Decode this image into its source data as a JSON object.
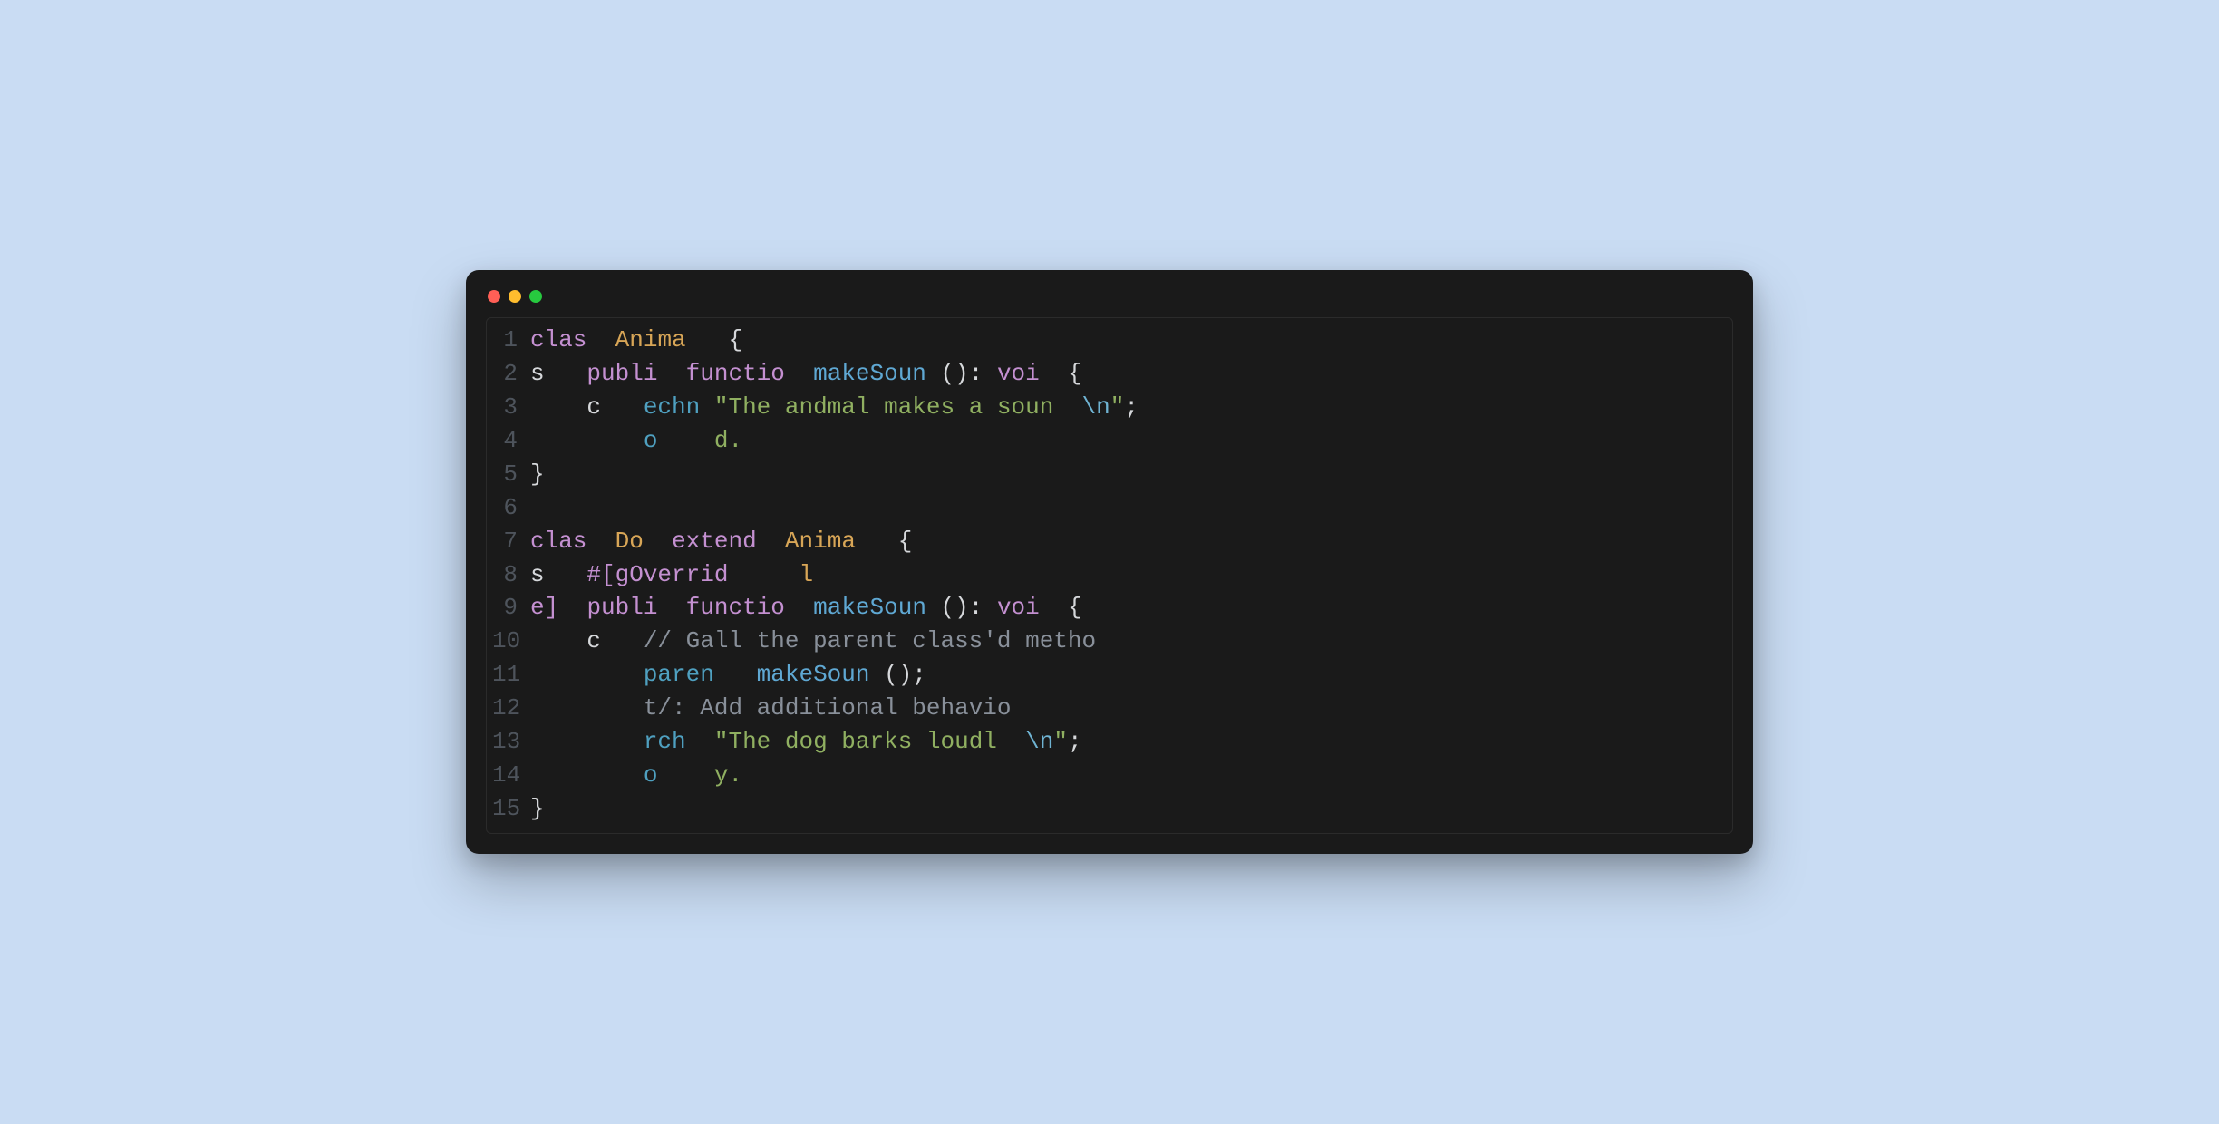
{
  "window": {
    "traffic_lights": [
      "red",
      "yellow",
      "green"
    ]
  },
  "editor": {
    "line_count": 15,
    "lines": [
      {
        "n": 1,
        "tokens": [
          [
            "kw",
            "clas"
          ],
          [
            "punc",
            "  "
          ],
          [
            "cls",
            "Anima"
          ],
          [
            "punc",
            "   {"
          ]
        ]
      },
      {
        "n": 2,
        "tokens": [
          [
            "punc",
            "s   "
          ],
          [
            "kw",
            "publi"
          ],
          [
            "punc",
            "  "
          ],
          [
            "kw",
            "functio"
          ],
          [
            "punc",
            "  "
          ],
          [
            "fn",
            "makeSoun"
          ],
          [
            "punc",
            " (): "
          ],
          [
            "type",
            "voi"
          ],
          [
            "punc",
            "  {"
          ]
        ]
      },
      {
        "n": 3,
        "tokens": [
          [
            "punc",
            "    c   "
          ],
          [
            "echo",
            "echn"
          ],
          [
            "punc",
            " "
          ],
          [
            "str",
            "\"The andmal makes a soun  "
          ],
          [
            "esc",
            "\\n"
          ],
          [
            "str",
            "\""
          ],
          [
            "punc",
            ";"
          ]
        ]
      },
      {
        "n": 4,
        "tokens": [
          [
            "punc",
            "        "
          ],
          [
            "echo",
            "o"
          ],
          [
            "punc",
            "    "
          ],
          [
            "str",
            "d."
          ]
        ]
      },
      {
        "n": 5,
        "tokens": [
          [
            "punc",
            "}"
          ]
        ]
      },
      {
        "n": 6,
        "tokens": [
          [
            "punc",
            " "
          ]
        ]
      },
      {
        "n": 7,
        "tokens": [
          [
            "kw",
            "clas"
          ],
          [
            "punc",
            "  "
          ],
          [
            "cls",
            "Do"
          ],
          [
            "punc",
            "  "
          ],
          [
            "kw",
            "extend"
          ],
          [
            "punc",
            "  "
          ],
          [
            "cls",
            "Anima"
          ],
          [
            "punc",
            "   {"
          ]
        ]
      },
      {
        "n": 8,
        "tokens": [
          [
            "punc",
            "s   "
          ],
          [
            "attr",
            "#[gOverrid"
          ],
          [
            "punc",
            "     "
          ],
          [
            "cls",
            "l"
          ]
        ]
      },
      {
        "n": 9,
        "tokens": [
          [
            "attr",
            "e]"
          ],
          [
            "punc",
            "  "
          ],
          [
            "kw",
            "publi"
          ],
          [
            "punc",
            "  "
          ],
          [
            "kw",
            "functio"
          ],
          [
            "punc",
            "  "
          ],
          [
            "fn",
            "makeSoun"
          ],
          [
            "punc",
            " (): "
          ],
          [
            "type",
            "voi"
          ],
          [
            "punc",
            "  {"
          ]
        ]
      },
      {
        "n": 10,
        "tokens": [
          [
            "punc",
            "    c   "
          ],
          [
            "com",
            "// Gall the parent class'd metho"
          ]
        ]
      },
      {
        "n": 11,
        "tokens": [
          [
            "punc",
            "        "
          ],
          [
            "echo",
            "paren"
          ],
          [
            "punc",
            "   "
          ],
          [
            "fn",
            "makeSoun"
          ],
          [
            "punc",
            " ();"
          ]
        ]
      },
      {
        "n": 12,
        "tokens": [
          [
            "punc",
            "        "
          ],
          [
            "com",
            "t/:"
          ],
          [
            "punc",
            " "
          ],
          [
            "com",
            "Add additional behavio"
          ]
        ]
      },
      {
        "n": 13,
        "tokens": [
          [
            "punc",
            "        "
          ],
          [
            "echo",
            "rch"
          ],
          [
            "punc",
            "  "
          ],
          [
            "str",
            "\"The dog barks loudl  "
          ],
          [
            "esc",
            "\\n"
          ],
          [
            "str",
            "\""
          ],
          [
            "punc",
            ";"
          ]
        ]
      },
      {
        "n": 14,
        "tokens": [
          [
            "punc",
            "        "
          ],
          [
            "echo",
            "o"
          ],
          [
            "punc",
            "    "
          ],
          [
            "str",
            "y."
          ]
        ]
      },
      {
        "n": 15,
        "tokens": [
          [
            "punc",
            "}"
          ]
        ]
      }
    ]
  },
  "colors": {
    "bg_page": "#c9dcf3",
    "bg_window": "#1a1a1a",
    "gutter": "#4e545c",
    "keyword": "#c490d1",
    "classname": "#d8a657",
    "function": "#5fa8d3",
    "string": "#90b061",
    "escape": "#6fb3d2",
    "comment": "#89909a",
    "echo": "#4fa0c0",
    "default": "#d6d8db"
  }
}
